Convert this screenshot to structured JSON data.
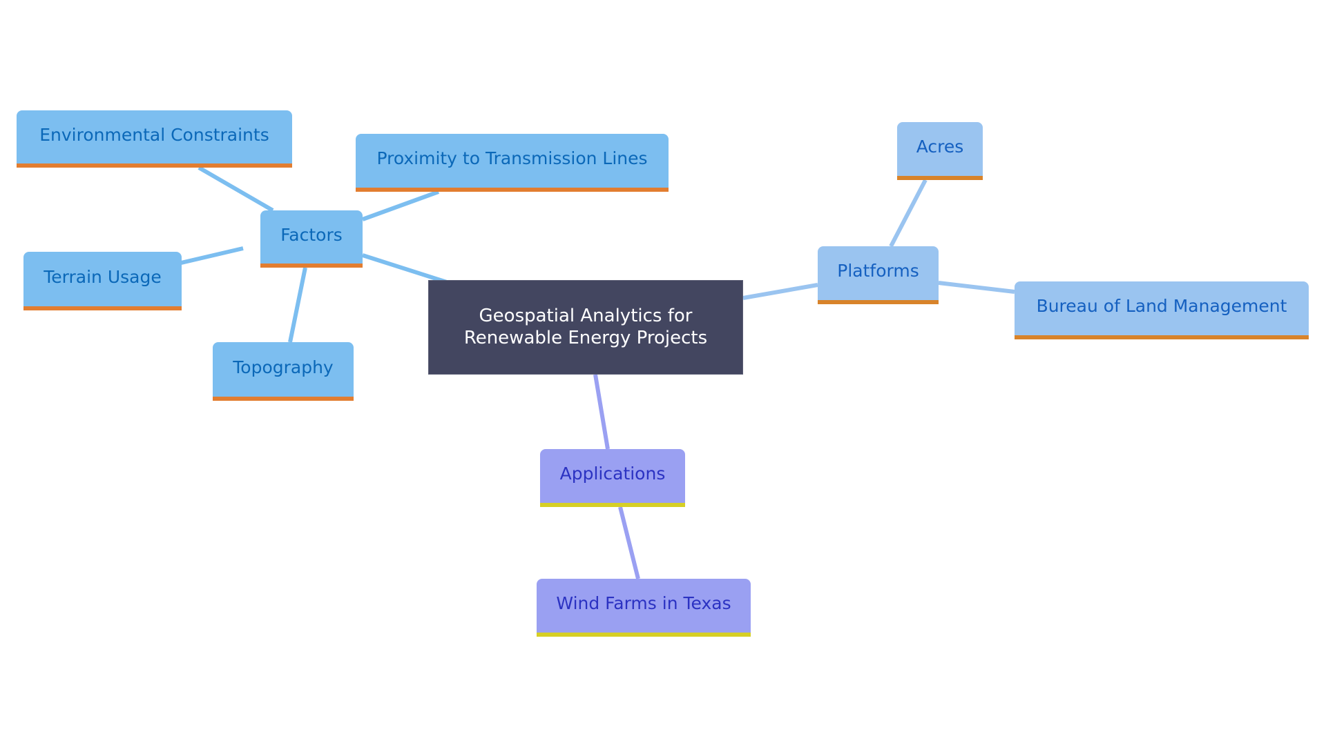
{
  "diagram": {
    "type": "mindmap",
    "root": {
      "label": "Geospatial Analytics for Renewable Energy Projects"
    },
    "branches": [
      {
        "id": "factors",
        "label": "Factors",
        "children": [
          {
            "id": "environmental",
            "label": "Environmental Constraints"
          },
          {
            "id": "proximity",
            "label": "Proximity to Transmission Lines"
          },
          {
            "id": "terrain",
            "label": "Terrain Usage"
          },
          {
            "id": "topography",
            "label": "Topography"
          }
        ]
      },
      {
        "id": "platforms",
        "label": "Platforms",
        "children": [
          {
            "id": "acres",
            "label": "Acres"
          },
          {
            "id": "blm",
            "label": "Bureau of Land Management"
          }
        ]
      },
      {
        "id": "applications",
        "label": "Applications",
        "children": [
          {
            "id": "windfarms",
            "label": "Wind Farms in Texas"
          }
        ]
      }
    ],
    "colors": {
      "factors_fill": "#7cbef0",
      "platforms_fill": "#9ac4f0",
      "applications_fill": "#9aa0f2",
      "root_fill": "#434660",
      "factors_edge": "#7cbef0",
      "platforms_edge": "#9ac4f0",
      "applications_edge": "#9aa0f2",
      "accent_orange": "#e27d30",
      "accent_yellow": "#d6cf25"
    }
  }
}
